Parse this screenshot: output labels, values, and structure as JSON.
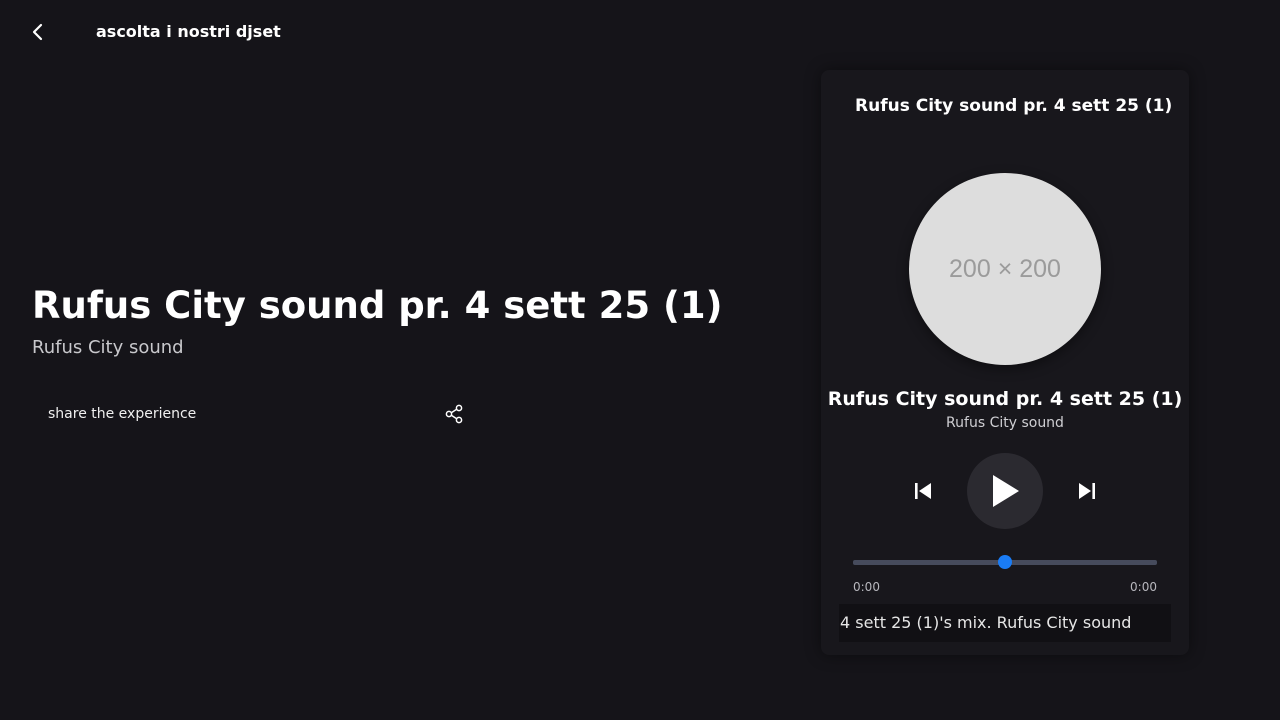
{
  "header": {
    "back_icon": "chevron-left-icon",
    "title": "ascolta i nostri djset"
  },
  "hero": {
    "title": "Rufus City sound pr. 4 sett 25 (1)",
    "subtitle": "Rufus City sound"
  },
  "share": {
    "label": "share the experience",
    "icon": "share-icon"
  },
  "player": {
    "header_title": "Rufus City sound pr. 4 sett 25 (1)",
    "cover_placeholder": "200 × 200",
    "track_title": "Rufus City sound pr. 4 sett 25 (1)",
    "track_artist": "Rufus City sound",
    "controls": {
      "previous_icon": "skip-previous-icon",
      "play_icon": "play-icon",
      "next_icon": "skip-next-icon"
    },
    "progress": {
      "fraction": 0.5,
      "current_time": "0:00",
      "total_time": "0:00"
    },
    "marquee_text": "4 sett 25 (1)'s mix. Rufus City sound",
    "colors": {
      "accent": "#1a7cf5",
      "track": "#464b5c",
      "background": "#151419"
    }
  }
}
